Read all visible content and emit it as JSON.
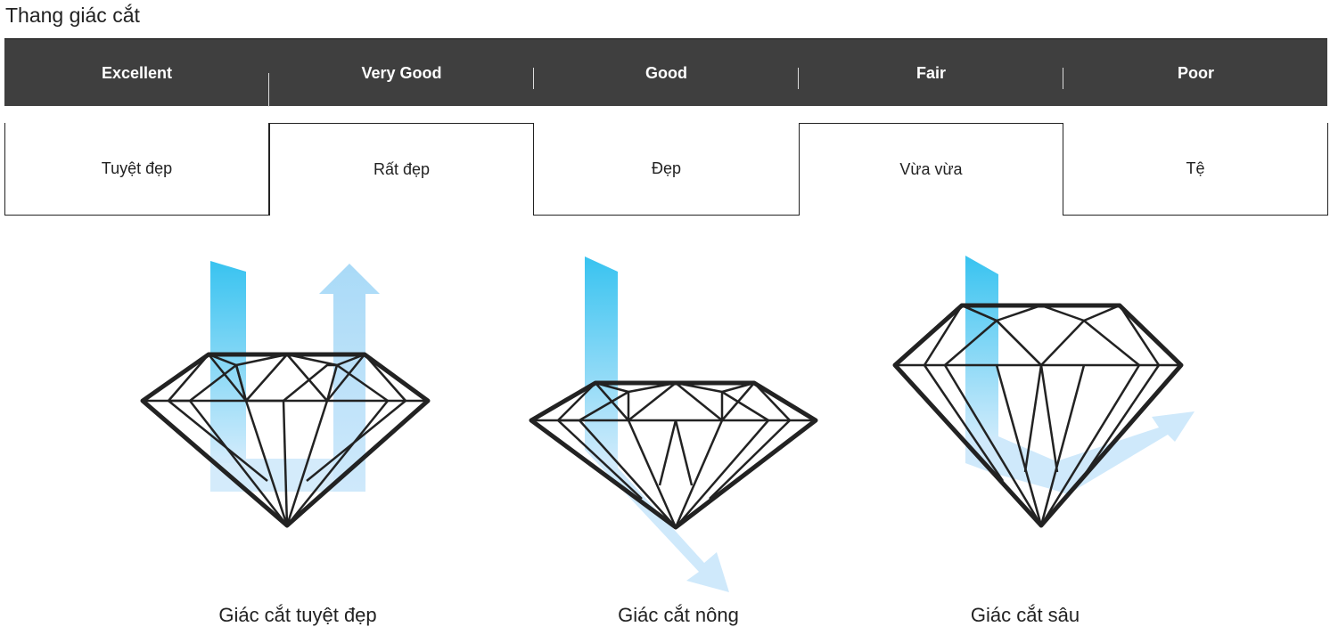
{
  "title": "Thang giác cắt",
  "grades": [
    {
      "en": "Excellent",
      "vi": "Tuyệt đẹp"
    },
    {
      "en": "Very Good",
      "vi": "Rất đẹp"
    },
    {
      "en": "Good",
      "vi": "Đẹp"
    },
    {
      "en": "Fair",
      "vi": "Vừa vừa"
    },
    {
      "en": "Poor",
      "vi": "Tệ"
    }
  ],
  "diagrams": [
    {
      "caption": "Giác cắt tuyệt đẹp"
    },
    {
      "caption": "Giác cắt nông"
    },
    {
      "caption": "Giác cắt sâu"
    }
  ],
  "colors": {
    "bar": "#3f3f3f",
    "light_ray": "#38c3f0",
    "light_ray_pale": "#bfe3fb",
    "outline": "#222222"
  }
}
